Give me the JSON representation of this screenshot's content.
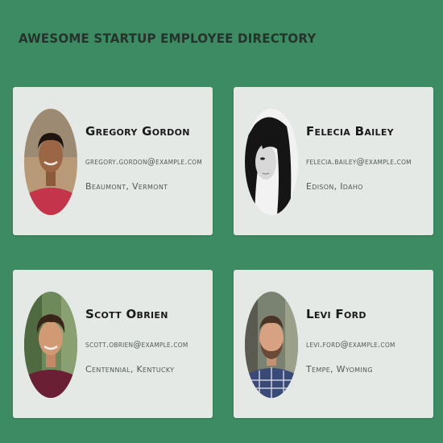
{
  "header": {
    "title": "Awesome Startup Employee Directory"
  },
  "employees": [
    {
      "name": "Gregory Gordon",
      "email": "gregory.gordon@example.com",
      "location": "Beaumont, Vermont",
      "avatar": "photo-man-dark-hair-red-shirt"
    },
    {
      "name": "Felecia Bailey",
      "email": "felecia.bailey@example.com",
      "location": "Edison, Idaho",
      "avatar": "photo-woman-black-hair-bw"
    },
    {
      "name": "Scott Obrien",
      "email": "scott.obrien@example.com",
      "location": "Centennial, Kentucky",
      "avatar": "photo-man-curly-hair-maroon-shirt"
    },
    {
      "name": "Levi Ford",
      "email": "levi.ford@example.com",
      "location": "Tempe, Wyoming",
      "avatar": "photo-man-beard-plaid-shirt"
    }
  ],
  "colors": {
    "background": "#3d8b62",
    "card": "#e4e9e6",
    "title": "#26332d",
    "name": "#1a1a1a",
    "detail": "#505a55"
  }
}
